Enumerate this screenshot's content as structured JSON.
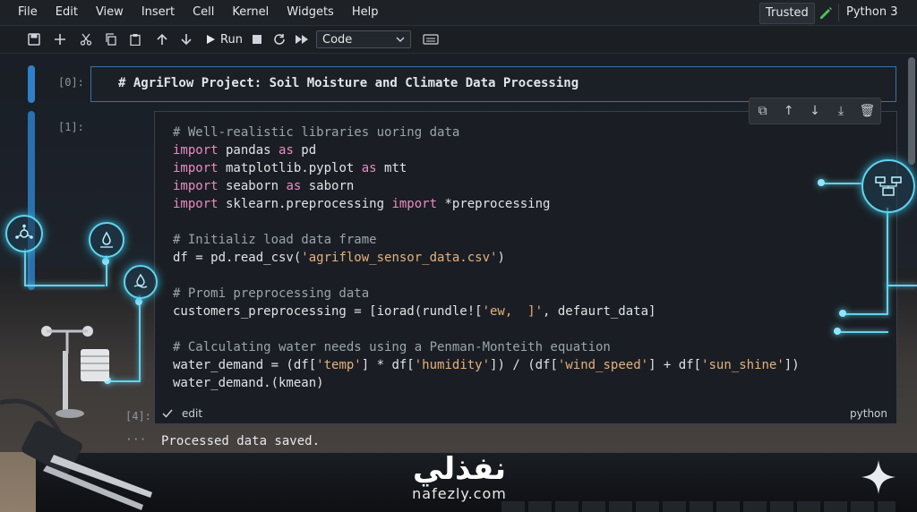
{
  "menubar": {
    "items": [
      "File",
      "Edit",
      "View",
      "Insert",
      "Cell",
      "Kernel",
      "Widgets",
      "Help"
    ],
    "trusted": "Trusted",
    "kernel": "Python 3"
  },
  "toolbar": {
    "run_label": "Run",
    "cell_type": "Code"
  },
  "cells": {
    "markdown": {
      "prompt": "[0]:",
      "text": "# AgriFlow Project: Soil Moisture and Climate Data Processing"
    },
    "code": {
      "prompt": "[1]:",
      "foot_prompt": "[4]:",
      "mode": "edit",
      "language": "python"
    }
  },
  "output": {
    "dots": "···",
    "text": "Processed data saved."
  },
  "brand": {
    "arabic": "نفذلي",
    "latin": "nafezly.com"
  },
  "colors": {
    "accent": "#2f80c8",
    "glow": "#63d3ee",
    "keyword": "#e88cc2",
    "string": "#e7b07a"
  }
}
